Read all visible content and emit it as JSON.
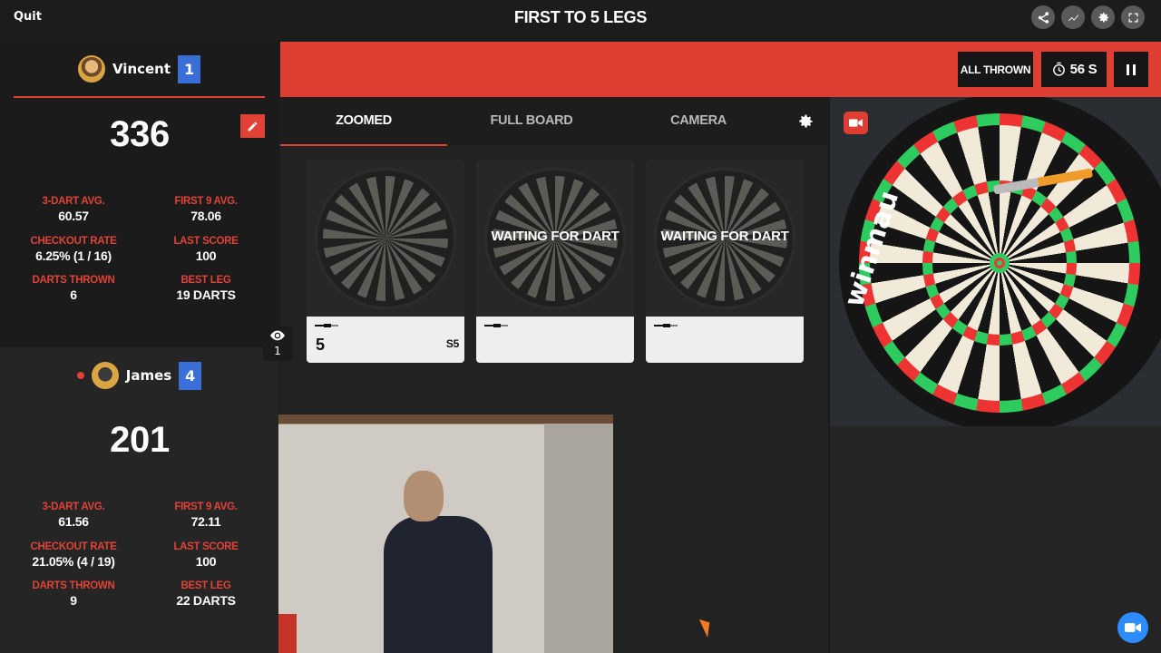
{
  "header": {
    "quit_label": "Quit",
    "title": "FIRST TO 5 LEGS",
    "icons": [
      "share-icon",
      "stats-icon",
      "settings-icon",
      "fullscreen-icon"
    ]
  },
  "players": [
    {
      "name": "Vincent",
      "legs": "1",
      "score": "336",
      "stats": {
        "three_dart_avg_label": "3-DART AVG.",
        "three_dart_avg": "60.57",
        "first9_label": "FIRST 9 AVG.",
        "first9": "78.06",
        "checkout_label": "CHECKOUT RATE",
        "checkout": "6.25% (1 / 16)",
        "last_score_label": "LAST SCORE",
        "last_score": "100",
        "darts_thrown_label": "DARTS THROWN",
        "darts_thrown": "6",
        "best_leg_label": "BEST LEG",
        "best_leg": "19 DARTS"
      }
    },
    {
      "name": "James",
      "legs": "4",
      "score": "201",
      "stats": {
        "three_dart_avg_label": "3-DART AVG.",
        "three_dart_avg": "61.56",
        "first9_label": "FIRST 9 AVG.",
        "first9": "72.11",
        "checkout_label": "CHECKOUT RATE",
        "checkout": "21.05% (4 / 19)",
        "last_score_label": "LAST SCORE",
        "last_score": "100",
        "darts_thrown_label": "DARTS THROWN",
        "darts_thrown": "9",
        "best_leg_label": "BEST LEG",
        "best_leg": "22 DARTS"
      }
    }
  ],
  "spectators": {
    "count": "1"
  },
  "controls": {
    "all_thrown_label": "ALL THROWN",
    "timer": "56 S"
  },
  "tabs": [
    {
      "label": "ZOOMED",
      "active": true
    },
    {
      "label": "FULL BOARD",
      "active": false
    },
    {
      "label": "CAMERA",
      "active": false
    }
  ],
  "dart_cards": [
    {
      "status": "",
      "score": "5",
      "code": "S5"
    },
    {
      "status": "WAITING FOR DART",
      "score": "",
      "code": ""
    },
    {
      "status": "WAITING FOR DART",
      "score": "",
      "code": ""
    }
  ],
  "board_cam": {
    "brand_text": "winmau"
  },
  "colors": {
    "accent": "#df3f33",
    "legs_badge": "#3b6fd8",
    "fab": "#2d8cff"
  }
}
